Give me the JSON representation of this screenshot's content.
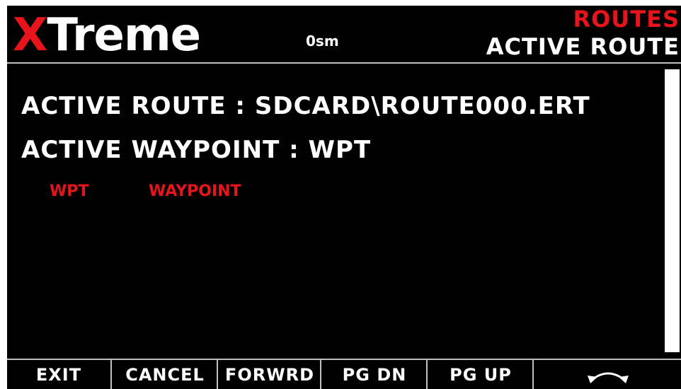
{
  "header": {
    "logo_x": "X",
    "logo_rest": "Treme",
    "distance": "0sm",
    "section": "ROUTES",
    "title": "ACTIVE ROUTE"
  },
  "content": {
    "active_route_line": "ACTIVE ROUTE : SDCARD\\ROUTE000.ERT",
    "active_waypoint_line": "ACTIVE WAYPOINT : WPT",
    "waypoints": [
      {
        "id": "WPT",
        "name": "WAYPOINT"
      }
    ]
  },
  "softkeys": {
    "k1": "EXIT",
    "k2": "CANCEL",
    "k3": "FORWRD",
    "k4": "PG DN",
    "k5": "PG UP",
    "k6_icon": "swap-arrows-icon"
  },
  "colors": {
    "background": "#000000",
    "text": "#ffffff",
    "accent": "#e8141c",
    "rule": "#bfbfbf"
  }
}
